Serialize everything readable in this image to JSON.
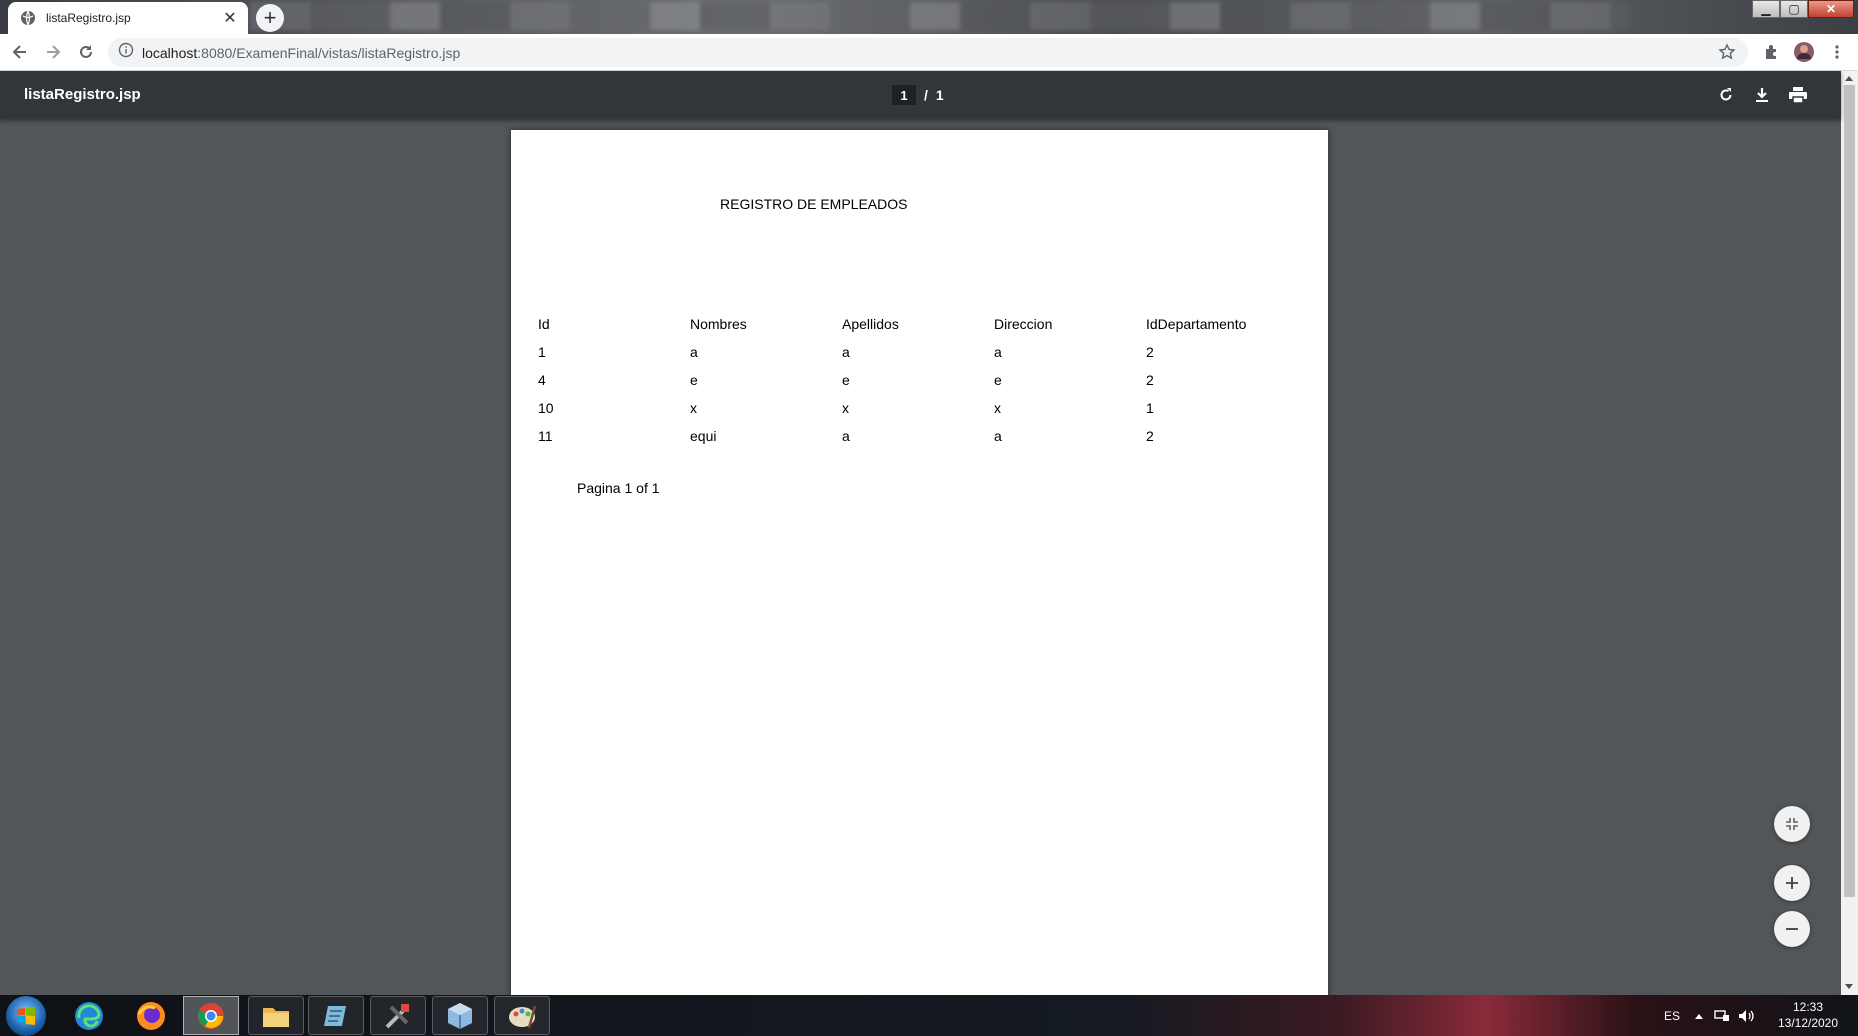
{
  "browser": {
    "tab_title": "listaRegistro.jsp",
    "url_host": "localhost",
    "url_rest": ":8080/ExamenFinal/vistas/listaRegistro.jsp",
    "icons": [
      "back-icon",
      "forward-icon",
      "reload-icon",
      "info-icon",
      "star-icon",
      "extensions-icon",
      "profile-avatar",
      "menu-icon"
    ]
  },
  "pdf": {
    "doc_title": "listaRegistro.jsp",
    "current_page": "1",
    "page_separator": "/",
    "total_pages": "1",
    "heading": "REGISTRO DE EMPLEADOS",
    "columns": [
      "Id",
      "Nombres",
      "Apellidos",
      "Direccion",
      "IdDepartamento"
    ],
    "rows": [
      [
        "1",
        "a",
        "a",
        "a",
        "2"
      ],
      [
        "4",
        "e",
        "e",
        "e",
        "2"
      ],
      [
        "10",
        "x",
        "x",
        "x",
        "1"
      ],
      [
        "11",
        "equi",
        "a",
        "a",
        "2"
      ]
    ],
    "footer": "Pagina 1 of 1"
  },
  "taskbar": {
    "language": "ES",
    "time": "12:33",
    "date": "13/12/2020",
    "apps": [
      "start-orb",
      "edge",
      "firefox",
      "chrome",
      "file-explorer",
      "text-editor",
      "tools",
      "virtualbox",
      "paint"
    ]
  }
}
